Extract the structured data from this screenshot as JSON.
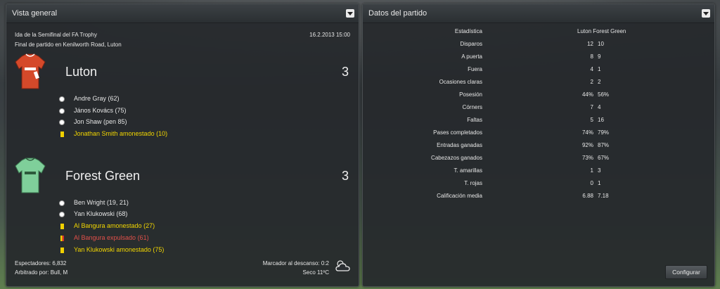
{
  "overview": {
    "title": "Vista general",
    "competition": "Ida de la Semifinal del FA Trophy",
    "venue": "Final de partido en Kenilworth Road, Luton",
    "datetime": "16.2.2013 15:00",
    "home": {
      "name": "Luton",
      "score": "3",
      "kit_color": "#d5492a",
      "events": [
        {
          "type": "goal",
          "text": "Andre Gray (62)"
        },
        {
          "type": "goal",
          "text": "János Kovács (75)"
        },
        {
          "type": "goal",
          "text": "Jon Shaw (pen 85)"
        },
        {
          "type": "yellow",
          "text": "Jonathan Smith amonestado (10)"
        }
      ]
    },
    "away": {
      "name": "Forest Green",
      "score": "3",
      "kit_color": "#7fcf9a",
      "events": [
        {
          "type": "goal",
          "text": "Ben Wright (19, 21)"
        },
        {
          "type": "goal",
          "text": "Yan Klukowski (68)"
        },
        {
          "type": "yellow",
          "text": "Al Bangura amonestado (27)"
        },
        {
          "type": "red",
          "text": "Al Bangura expulsado (61)"
        },
        {
          "type": "yellow",
          "text": "Yan Klukowski amonestado (75)"
        }
      ]
    },
    "attendance": "Espectadores: 6,832",
    "referee": "Arbitrado por: Bull, M",
    "halftime": "Marcador al descanso: 0:2",
    "weather": "Seco 11ºC"
  },
  "stats": {
    "title": "Datos del partido",
    "header": {
      "label": "Estadística",
      "teams": "Luton Forest Green"
    },
    "rows": [
      {
        "label": "Disparos",
        "home": "12",
        "away": "10"
      },
      {
        "label": "A puerta",
        "home": "8",
        "away": "9"
      },
      {
        "label": "Fuera",
        "home": "4",
        "away": "1"
      },
      {
        "label": "Ocasiones claras",
        "home": "2",
        "away": "2"
      },
      {
        "label": "Posesión",
        "home": "44%",
        "away": "56%"
      },
      {
        "label": "Córners",
        "home": "7",
        "away": "4"
      },
      {
        "label": "Faltas",
        "home": "5",
        "away": "16"
      },
      {
        "label": "Pases completados",
        "home": "74%",
        "away": "79%"
      },
      {
        "label": "Entradas ganadas",
        "home": "92%",
        "away": "87%"
      },
      {
        "label": "Cabezazos ganados",
        "home": "73%",
        "away": "67%"
      },
      {
        "label": "T. amarillas",
        "home": "1",
        "away": "3"
      },
      {
        "label": "T. rojas",
        "home": "0",
        "away": "1"
      },
      {
        "label": "Calificación media",
        "home": "6.88",
        "away": "7.18"
      }
    ],
    "configure_label": "Configurar"
  }
}
